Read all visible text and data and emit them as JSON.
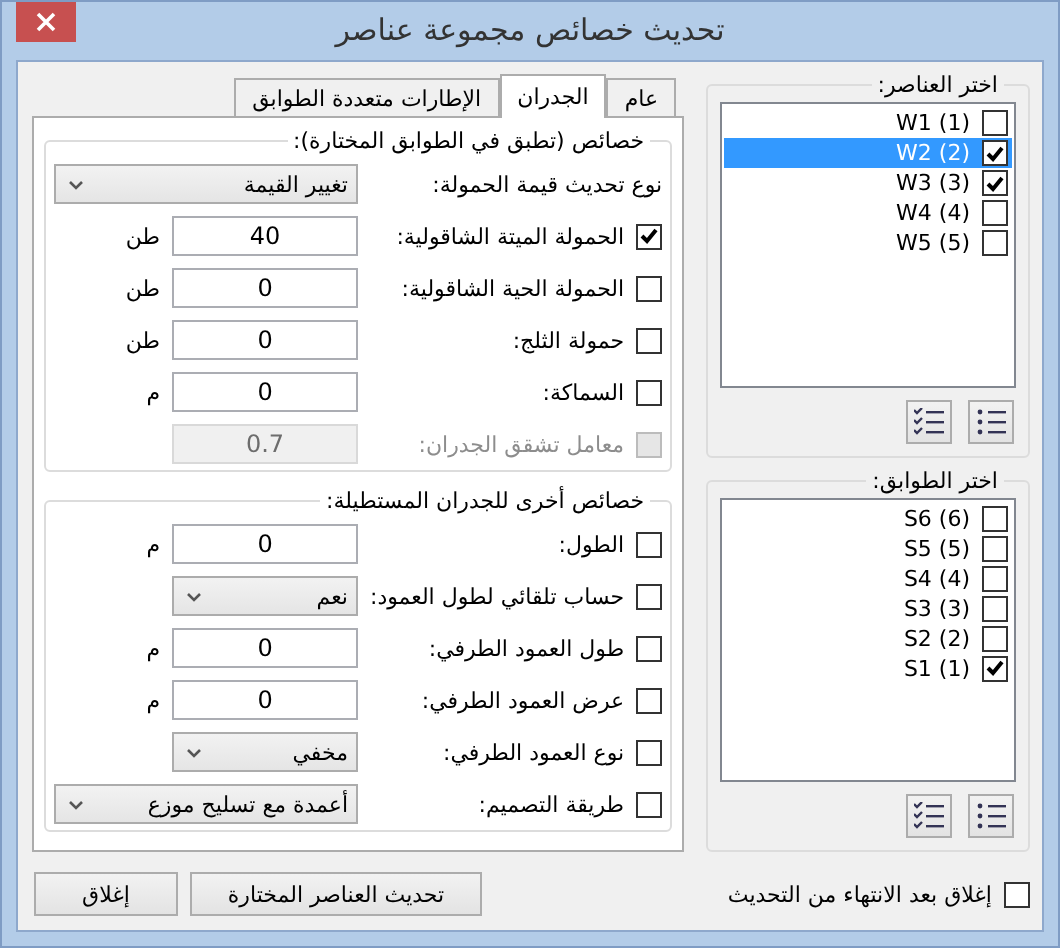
{
  "window": {
    "title": "تحديث خصائص مجموعة عناصر"
  },
  "tabs": [
    {
      "label": "عام",
      "selected": false
    },
    {
      "label": "الجدران",
      "selected": true
    },
    {
      "label": "الإطارات متعددة الطوابق",
      "selected": false
    }
  ],
  "groups": [
    {
      "title": "خصائص (تطبق في الطوابق المختارة):",
      "rows": [
        {
          "kind": "plain",
          "label": "نوع تحديث قيمة الحمولة:",
          "control": {
            "kind": "select",
            "value": "تغيير القيمة",
            "wide": true
          }
        },
        {
          "kind": "check",
          "checked": true,
          "disabled": false,
          "label": "الحمولة الميتة الشاقولية:",
          "control": {
            "kind": "input",
            "value": "40",
            "unit": "طن"
          }
        },
        {
          "kind": "check",
          "checked": false,
          "disabled": false,
          "label": "الحمولة الحية الشاقولية:",
          "control": {
            "kind": "input",
            "value": "0",
            "unit": "طن"
          }
        },
        {
          "kind": "check",
          "checked": false,
          "disabled": false,
          "label": "حمولة الثلج:",
          "control": {
            "kind": "input",
            "value": "0",
            "unit": "طن"
          }
        },
        {
          "kind": "check",
          "checked": false,
          "disabled": false,
          "label": "السماكة:",
          "control": {
            "kind": "input",
            "value": "0",
            "unit": "م"
          }
        },
        {
          "kind": "check",
          "checked": false,
          "disabled": true,
          "label": "معامل تشقق الجدران:",
          "control": {
            "kind": "input",
            "value": "0.7"
          }
        }
      ]
    },
    {
      "title": "خصائص أخرى للجدران المستطيلة:",
      "rows": [
        {
          "kind": "check",
          "checked": false,
          "disabled": false,
          "label": "الطول:",
          "control": {
            "kind": "input",
            "value": "0",
            "unit": "م"
          }
        },
        {
          "kind": "check",
          "checked": false,
          "disabled": false,
          "label": "حساب تلقائي لطول العمود:",
          "control": {
            "kind": "select",
            "value": "نعم",
            "wide": false
          }
        },
        {
          "kind": "check",
          "checked": false,
          "disabled": false,
          "label": "طول العمود الطرفي:",
          "control": {
            "kind": "input",
            "value": "0",
            "unit": "م"
          }
        },
        {
          "kind": "check",
          "checked": false,
          "disabled": false,
          "label": "عرض العمود الطرفي:",
          "control": {
            "kind": "input",
            "value": "0",
            "unit": "م"
          }
        },
        {
          "kind": "check",
          "checked": false,
          "disabled": false,
          "label": "نوع العمود الطرفي:",
          "control": {
            "kind": "select",
            "value": "مخفي",
            "wide": false
          }
        },
        {
          "kind": "check",
          "checked": false,
          "disabled": false,
          "label": "طريقة التصميم:",
          "control": {
            "kind": "select",
            "value": "أعمدة مع تسليح موزع",
            "wide": true
          }
        }
      ]
    }
  ],
  "lists": [
    {
      "title": "اختر العناصر:",
      "items": [
        {
          "label": "W1 (1)",
          "checked": false,
          "selected": false
        },
        {
          "label": "W2 (2)",
          "checked": true,
          "selected": true
        },
        {
          "label": "W3 (3)",
          "checked": true,
          "selected": false
        },
        {
          "label": "W4 (4)",
          "checked": false,
          "selected": false
        },
        {
          "label": "W5 (5)",
          "checked": false,
          "selected": false
        }
      ]
    },
    {
      "title": "اختر الطوابق:",
      "items": [
        {
          "label": "S6 (6)",
          "checked": false,
          "selected": false
        },
        {
          "label": "S5 (5)",
          "checked": false,
          "selected": false
        },
        {
          "label": "S4 (4)",
          "checked": false,
          "selected": false
        },
        {
          "label": "S3 (3)",
          "checked": false,
          "selected": false
        },
        {
          "label": "S2 (2)",
          "checked": false,
          "selected": false
        },
        {
          "label": "S1 (1)",
          "checked": true,
          "selected": false
        }
      ]
    }
  ],
  "close_after_update": {
    "label": "إغلاق بعد الانتهاء من التحديث",
    "checked": false
  },
  "buttons": [
    "تحديث العناصر المختارة",
    "إغلاق"
  ]
}
